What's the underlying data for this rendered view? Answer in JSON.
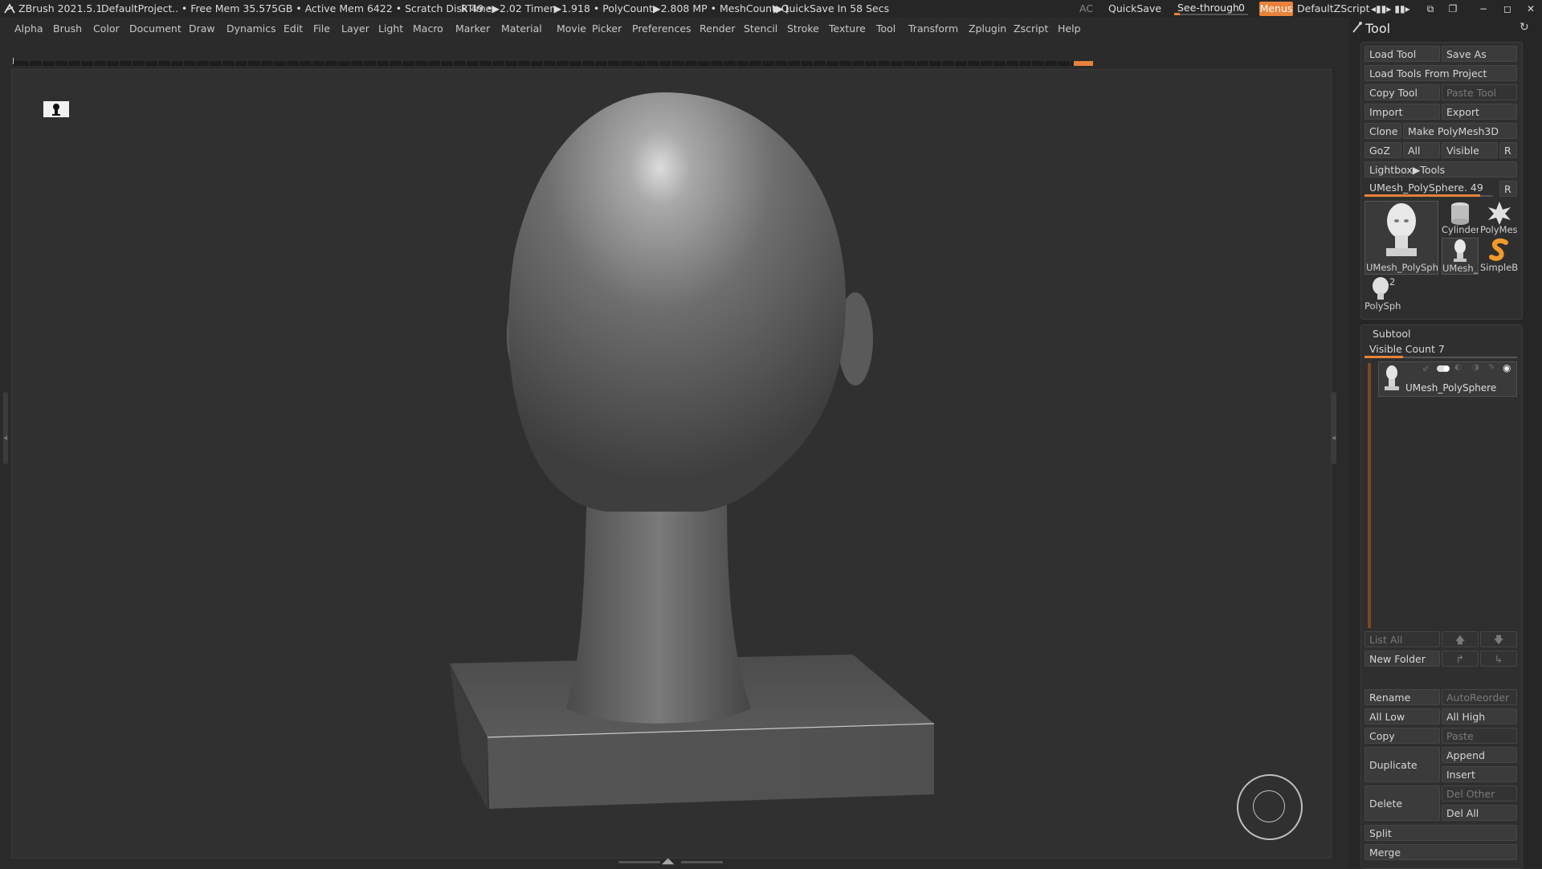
{
  "titlebar": {
    "app": "ZBrush 2021.5.1",
    "project": "DefaultProject",
    "stats": ".. • Free Mem 35.575GB • Active Mem 6422 • Scratch Disk 49 •",
    "rtime": "RTime▶2.02 Timer▶1.918 • PolyCount▶2.808 MP  • MeshCount▶1",
    "quicksave_info": "▶QuickSave In 58 Secs",
    "ac": "AC",
    "quicksave": "QuickSave",
    "seethrough_label": "See-through",
    "seethrough_value": "0",
    "seethrough_level": 0.08,
    "menus": "Menus",
    "script": "DefaultZScript"
  },
  "menubar": [
    "Alpha",
    "Brush",
    "Color",
    "Document",
    "Draw",
    "Dynamics",
    "Edit",
    "File",
    "Layer",
    "Light",
    "Macro",
    "Marker",
    "Material",
    "Movie",
    "Picker",
    "Preferences",
    "Render",
    "Stencil",
    "Stroke",
    "Texture",
    "Tool",
    "Transform",
    "Zplugin",
    "Zscript",
    "Help"
  ],
  "tool_panel": {
    "title": "Tool",
    "load_tool": "Load Tool",
    "save_as": "Save As",
    "load_from_project": "Load Tools From Project",
    "copy_tool": "Copy Tool",
    "paste_tool": "Paste Tool",
    "import": "Import",
    "export": "Export",
    "clone": "Clone",
    "make_polymesh": "Make PolyMesh3D",
    "goz": "GoZ",
    "all": "All",
    "visible": "Visible",
    "r": "R",
    "lightbox_tools": "Lightbox▶Tools",
    "current_tool": "UMesh_PolySphere. 49",
    "current_tool_r": "R",
    "tool_slider_level": 0.9,
    "thumbs": {
      "main": "UMesh_PolySphe",
      "cylinder": "Cylinder",
      "polymesh": "PolyMes",
      "umesh_small": "UMesh_",
      "simpleb": "SimpleB",
      "polysph": "PolySph",
      "polysph_count": "2"
    }
  },
  "subtool": {
    "title": "Subtool",
    "visible_count": "Visible Count 7",
    "visible_count_level": 0.25,
    "item_name": "UMesh_PolySphere",
    "list_all": "List All",
    "new_folder": "New Folder",
    "rename": "Rename",
    "autoreorder": "AutoReorder",
    "all_low": "All Low",
    "all_high": "All High",
    "copy": "Copy",
    "paste": "Paste",
    "duplicate": "Duplicate",
    "append": "Append",
    "insert": "Insert",
    "delete": "Delete",
    "del_other": "Del Other",
    "del_all": "Del All",
    "split": "Split",
    "merge": "Merge"
  },
  "colors": {
    "accent": "#e8823a",
    "panel": "#262626",
    "viewport": "#303030",
    "button": "#3b3b3b"
  }
}
